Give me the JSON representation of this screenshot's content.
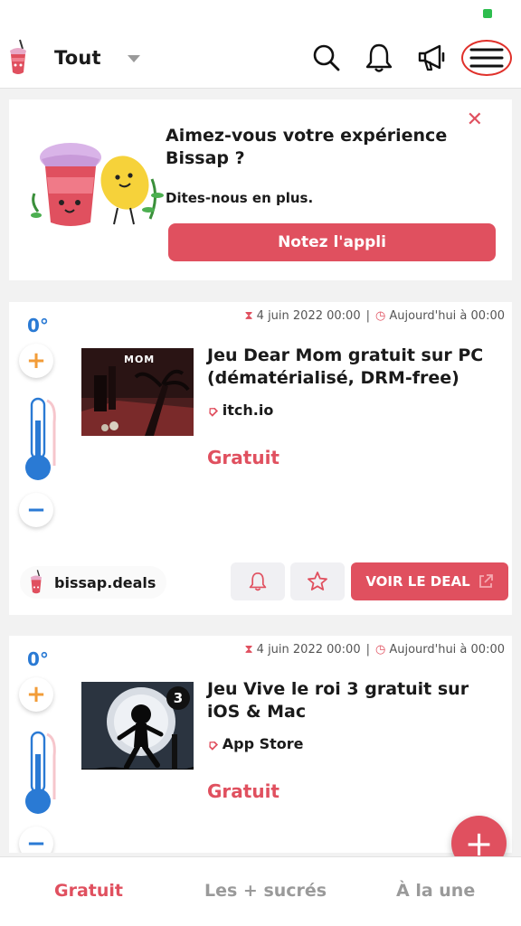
{
  "header": {
    "filter_label": "Tout"
  },
  "icons": {
    "search": "search-icon",
    "bell": "bell-icon",
    "megaphone": "megaphone-icon",
    "menu": "hamburger-menu-icon"
  },
  "rating_prompt": {
    "title": "Aimez-vous votre expérience Bissap ?",
    "subtitle": "Dites-nous en plus.",
    "button": "Notez l'appli",
    "close": "✕"
  },
  "deals": [
    {
      "temperature": "0°",
      "start_date": "4 juin 2022 00:00",
      "separator": "|",
      "published": "Aujourd'hui à 00:00",
      "title": "Jeu Dear Mom gratuit sur PC (dématérialisé, DRM-free)",
      "merchant": "itch.io",
      "price": "Gratuit",
      "thumb_text": "MOM",
      "poster": "bissap.deals",
      "cta": "VOIR LE DEAL"
    },
    {
      "temperature": "0°",
      "start_date": "4 juin 2022 00:00",
      "separator": "|",
      "published": "Aujourd'hui à 00:00",
      "title": "Jeu Vive le roi 3 gratuit sur iOS & Mac",
      "merchant": "App Store",
      "price": "Gratuit",
      "thumb_badge": "3"
    }
  ],
  "vote": {
    "plus": "+",
    "minus": "−"
  },
  "fab": "+",
  "bottom_nav": [
    {
      "label": "Gratuit",
      "active": true
    },
    {
      "label": "Les + sucrés",
      "active": false
    },
    {
      "label": "À la une",
      "active": false
    }
  ],
  "colors": {
    "accent": "#e0505f",
    "cold": "#2a7ad4",
    "plus": "#f29c38"
  }
}
